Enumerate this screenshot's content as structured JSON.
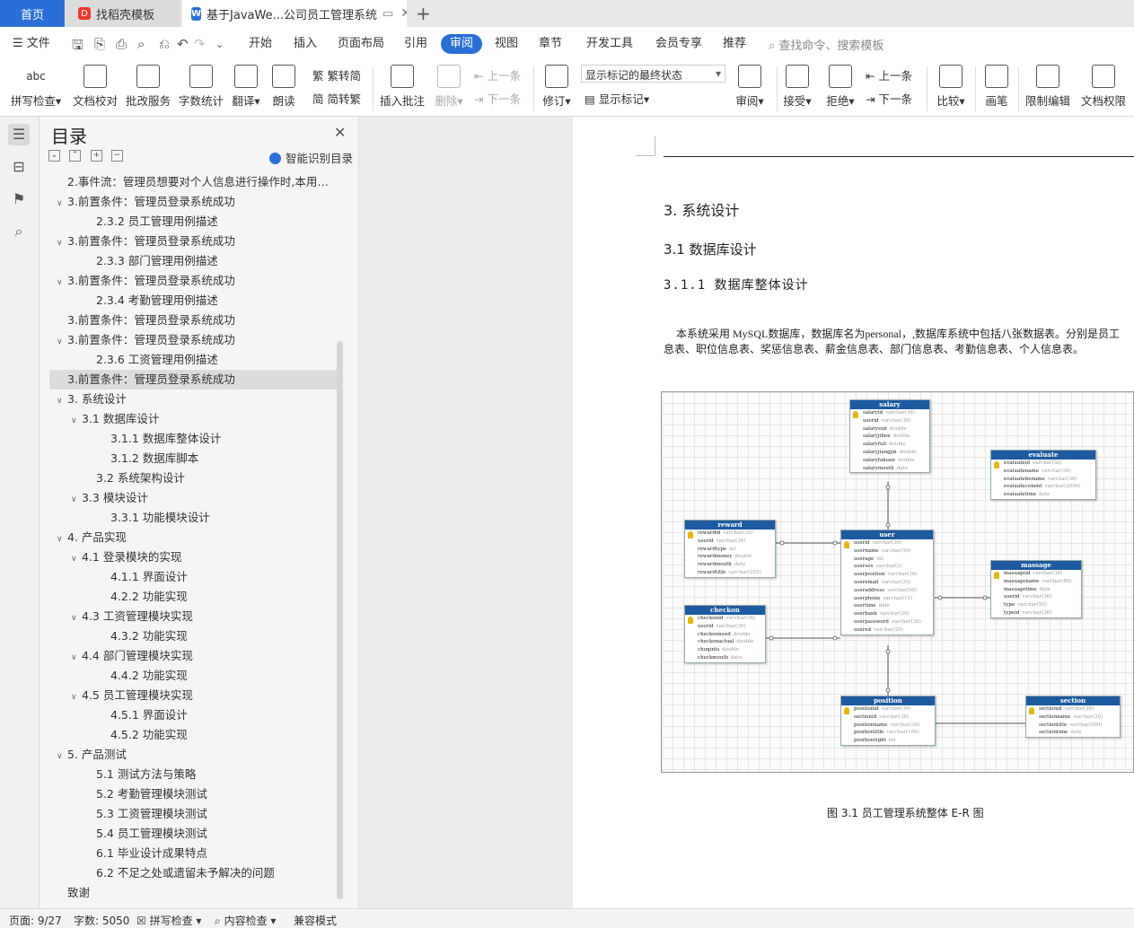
{
  "tabs": {
    "home": "首页",
    "template": "找稻壳模板",
    "doc": "基于JavaWe...公司员工管理系统"
  },
  "menu": {
    "file": "文件",
    "items": [
      "开始",
      "插入",
      "页面布局",
      "引用",
      "审阅",
      "视图",
      "章节",
      "开发工具",
      "会员专享",
      "推荐"
    ],
    "search": "查找命令、搜索模板"
  },
  "ribbon": {
    "spell": "拼写检查",
    "proof": "文档校对",
    "batch": "批改服务",
    "wordcount": "字数统计",
    "translate": "翻译",
    "read": "朗读",
    "trad": "繁转简",
    "simp": "简转繁",
    "insert_comment": "插入批注",
    "delete": "删除",
    "prev": "上一条",
    "next": "下一条",
    "revise": "修订",
    "mark_state": "显示标记的最终状态",
    "show_marks": "显示标记",
    "review": "审阅",
    "accept": "接受",
    "reject": "拒绝",
    "prev2": "上一条",
    "next2": "下一条",
    "compare": "比较",
    "pen": "画笔",
    "restrict": "限制编辑",
    "perm": "文档权限"
  },
  "toc": {
    "title": "目录",
    "smart": "智能识别目录",
    "items": [
      "2.事件流：管理员想要对个人信息进行操作时,本用例 ...",
      "3.前置条件：管理员登录系统成功",
      "2.3.2 员工管理用例描述",
      "3.前置条件：管理员登录系统成功",
      "2.3.3 部门管理用例描述",
      "3.前置条件：管理员登录系统成功",
      "2.3.4 考勤管理用例描述",
      "3.前置条件：管理员登录系统成功",
      "3.前置条件：管理员登录系统成功",
      "2.3.6 工资管理用例描述",
      "3.前置条件：管理员登录系统成功",
      "3. 系统设计",
      "3.1 数据库设计",
      "3.1.1 数据库整体设计",
      "3.1.2 数据库脚本",
      "3.2 系统架构设计",
      "3.3 模块设计",
      "3.3.1 功能模块设计",
      "4. 产品实现",
      "4.1 登录模块的实现",
      "4.1.1 界面设计",
      "4.2.2 功能实现",
      "4.3 工资管理模块实现",
      "4.3.2 功能实现",
      "4.4 部门管理模块实现",
      "4.4.2 功能实现",
      "4.5 员工管理模块实现",
      "4.5.1 界面设计",
      "4.5.2 功能实现",
      "5. 产品测试",
      "5.1 测试方法与策略",
      "5.2 考勤管理模块测试",
      "5.3 工资管理模块测试",
      "5.4 员工管理模块测试",
      "6.1 毕业设计成果特点",
      "6.2 不足之处或遗留未予解决的问题",
      "致谢"
    ]
  },
  "doc": {
    "h1": "3.  系统设计",
    "h2": "3.1  数据库设计",
    "h3": "3.1.1  数据库整体设计",
    "para1": "本系统采用 MySQL数据库，数据库名为personal，,数据库系统中包括八张数据表。分别是员工",
    "para2": "息表、职位信息表、奖惩信息表、薪金信息表、部门信息表、考勤信息表、个人信息表。",
    "caption": "图 3.1  员工管理系统整体 E-R 图"
  },
  "er_tables": {
    "salary": {
      "name": "salary",
      "fields": [
        [
          "salaryid",
          "varchar(36)"
        ],
        [
          "userid",
          "varchar(36)"
        ],
        [
          "salarysun",
          "double"
        ],
        [
          "salaryjiben",
          "double"
        ],
        [
          "salaryfuli",
          "double"
        ],
        [
          "salaryjiangjin",
          "double"
        ],
        [
          "salaryfakuan",
          "double"
        ],
        [
          "salarymouth",
          "date"
        ]
      ]
    },
    "evaluate": {
      "name": "evaluate",
      "fields": [
        [
          "evaluateid",
          "varchar(36)"
        ],
        [
          "evaluatename",
          "varchar(36)"
        ],
        [
          "evaluatebename",
          "varchar(36)"
        ],
        [
          "evaluateconent",
          "varchar(2000)"
        ],
        [
          "evaluatetime",
          "date"
        ]
      ]
    },
    "reward": {
      "name": "reward",
      "fields": [
        [
          "rewardid",
          "varchar(36)"
        ],
        [
          "userid",
          "varchar(36)"
        ],
        [
          "rewardtype",
          "int"
        ],
        [
          "rewardmoney",
          "double"
        ],
        [
          "rewardmouth",
          "date"
        ],
        [
          "rewardtitle",
          "varchar(255)"
        ]
      ]
    },
    "user": {
      "name": "user",
      "fields": [
        [
          "userid",
          "varchar(36)"
        ],
        [
          "username",
          "varchar(50)"
        ],
        [
          "userage",
          "int"
        ],
        [
          "usersex",
          "varchar(2)"
        ],
        [
          "userposition",
          "varchar(36)"
        ],
        [
          "useremail",
          "varchar(20)"
        ],
        [
          "useraddress",
          "varchar(50)"
        ],
        [
          "userphone",
          "varchar(11)"
        ],
        [
          "usertime",
          "date"
        ],
        [
          "userbank",
          "varchar(30)"
        ],
        [
          "userpassword",
          "varchar(30)"
        ],
        [
          "usered",
          "varchar(20)"
        ]
      ]
    },
    "massage": {
      "name": "massage",
      "fields": [
        [
          "massageid",
          "varchar(36)"
        ],
        [
          "massagename",
          "varchar(80)"
        ],
        [
          "massagetime",
          "date"
        ],
        [
          "userid",
          "varchar(36)"
        ],
        [
          "type",
          "varchar(50)"
        ],
        [
          "typeid",
          "varchar(36)"
        ]
      ]
    },
    "checkon": {
      "name": "checkon",
      "fields": [
        [
          "checkonid",
          "varchar(36)"
        ],
        [
          "userid",
          "varchar(36)"
        ],
        [
          "checkonneed",
          "double"
        ],
        [
          "checkonactual",
          "double"
        ],
        [
          "chuqinlu",
          "double"
        ],
        [
          "checkmouth",
          "date"
        ]
      ]
    },
    "position": {
      "name": "position",
      "fields": [
        [
          "positionid",
          "varchar(36)"
        ],
        [
          "sectionid",
          "varchar(36)"
        ],
        [
          "positionname",
          "varchar(36)"
        ],
        [
          "positiontitle",
          "varchar(100)"
        ],
        [
          "positionright",
          "int"
        ]
      ]
    },
    "section": {
      "name": "section",
      "fields": [
        [
          "sectionid",
          "varchar(36)"
        ],
        [
          "sectionname",
          "varchar(20)"
        ],
        [
          "sectiontitle",
          "varchar(500)"
        ],
        [
          "sectiontime",
          "date"
        ]
      ]
    }
  },
  "status": {
    "page": "页面: 9/27",
    "words": "字数: 5050",
    "spell": "拼写检查",
    "content": "内容检查",
    "compat": "兼容模式"
  }
}
